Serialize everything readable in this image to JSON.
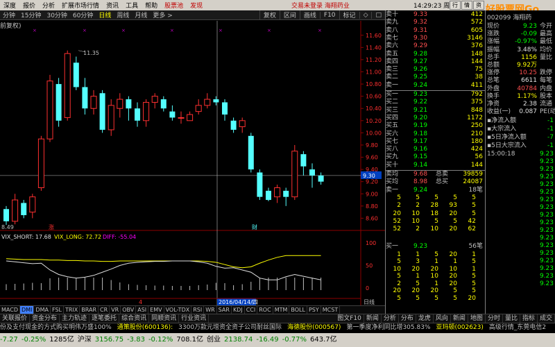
{
  "menu": {
    "items": [
      "深度",
      "报价",
      "分析",
      "扩展市场行情",
      "资讯",
      "工具",
      "帮助"
    ],
    "red_items": [
      "股票池",
      "发现"
    ],
    "notice": [
      "交易未登录",
      "海翔药业"
    ],
    "clock": "14:29:23",
    "weekday": "周五",
    "buttons": [
      "行",
      "情",
      "资"
    ]
  },
  "watermark": "好股票网Go",
  "periods": [
    "分钟",
    "15分钟",
    "30分钟",
    "60分钟",
    "日线",
    "周线",
    "月线",
    "更多 >"
  ],
  "period_right": [
    "复权",
    "区间",
    "画线",
    "F10",
    "标记",
    "◇",
    "□"
  ],
  "chart_title": "前复权)",
  "price_axis": [
    "11.60",
    "11.40",
    "11.20",
    "11.00",
    "10.80",
    "10.60",
    "10.40",
    "10.20",
    "10.00",
    "9.80",
    "9.60",
    "9.40",
    "9.30",
    "9.20",
    "9.00",
    "8.80",
    "8.60"
  ],
  "annotations": {
    "high": "11.35",
    "low": "8.49",
    "zhang": "涨",
    "cai": "财",
    "date": "2016/04/14/四",
    "four": "4"
  },
  "indicator": {
    "short": "VIX_SHORT: 17.68",
    "long": "VIX_LONG: 72.72",
    "diff": "DIFF: -55.04",
    "axis": [
      "100",
      "50",
      "0"
    ]
  },
  "indicator_buttons": [
    "MACD",
    "DMI",
    "DMA",
    "FSL",
    "TRIX",
    "BRAR",
    "CR",
    "VR",
    "OBV",
    "ASI",
    "EMV",
    "VOL-TDX",
    "RSI",
    "WR",
    "SAR",
    "KDJ",
    "CCI",
    "ROC",
    "MTM",
    "BOLL",
    "PSY",
    "MCST"
  ],
  "indicator_active": "DMI",
  "sub_tab": "日线",
  "orderbook": {
    "asks": [
      {
        "label": "卖十",
        "price": "9.33",
        "vol": "412"
      },
      {
        "label": "卖九",
        "price": "9.32",
        "vol": "572"
      },
      {
        "label": "卖八",
        "price": "9.31",
        "vol": "605"
      },
      {
        "label": "卖七",
        "price": "9.30",
        "vol": "3146"
      },
      {
        "label": "卖六",
        "price": "9.29",
        "vol": "376"
      },
      {
        "label": "卖五",
        "price": "9.28",
        "vol": "148"
      },
      {
        "label": "卖四",
        "price": "9.27",
        "vol": "144"
      },
      {
        "label": "卖三",
        "price": "9.26",
        "vol": "75"
      },
      {
        "label": "卖二",
        "price": "9.25",
        "vol": "38"
      },
      {
        "label": "卖一",
        "price": "9.24",
        "vol": "411"
      }
    ],
    "bids": [
      {
        "label": "买一",
        "price": "9.23",
        "vol": "792"
      },
      {
        "label": "买二",
        "price": "9.22",
        "vol": "375"
      },
      {
        "label": "买三",
        "price": "9.21",
        "vol": "848"
      },
      {
        "label": "买四",
        "price": "9.20",
        "vol": "1172"
      },
      {
        "label": "买五",
        "price": "9.19",
        "vol": "250"
      },
      {
        "label": "买六",
        "price": "9.18",
        "vol": "210"
      },
      {
        "label": "买七",
        "price": "9.17",
        "vol": "180"
      },
      {
        "label": "买八",
        "price": "9.16",
        "vol": "424"
      },
      {
        "label": "买九",
        "price": "9.15",
        "vol": "56"
      },
      {
        "label": "买十",
        "price": "9.14",
        "vol": "144"
      }
    ],
    "avg_ask": {
      "label": "卖均",
      "price": "9.68",
      "k": "总卖",
      "v": "39859"
    },
    "avg_bid": {
      "label": "买均",
      "price": "8.98",
      "k": "总买",
      "v": "24087"
    },
    "sell1_row": {
      "label": "卖一",
      "price": "9.24",
      "right": "18笔"
    },
    "buy1_row": {
      "label": "买一",
      "price": "9.23",
      "right": "56笔"
    }
  },
  "ticks_top": [
    [
      "5",
      "5",
      "5",
      "5",
      "5"
    ],
    [
      "2",
      "2",
      "28",
      "93",
      "5"
    ],
    [
      "20",
      "10",
      "18",
      "20",
      "5"
    ],
    [
      "52",
      "10",
      "5",
      "5",
      "42"
    ],
    [
      "52",
      "2",
      "10",
      "20",
      "62"
    ]
  ],
  "ticks_bottom": [
    [
      "1",
      "1",
      "5",
      "20",
      "1"
    ],
    [
      "5",
      "3",
      "1",
      "1",
      "5"
    ],
    [
      "10",
      "20",
      "20",
      "10",
      "1"
    ],
    [
      "5",
      "1",
      "10",
      "20",
      "5"
    ],
    [
      "2",
      "5",
      "1",
      "20",
      "5"
    ],
    [
      "20",
      "20",
      "20",
      "5",
      "5"
    ],
    [
      "5",
      "5",
      "5",
      "5",
      "20"
    ]
  ],
  "info": {
    "code": "002099 海翔药",
    "rows": [
      {
        "k": "现价",
        "v": "9.23",
        "k2": "今开",
        "cls": "g"
      },
      {
        "k": "涨跌",
        "v": "-0.09",
        "k2": "最高",
        "cls": "g"
      },
      {
        "k": "涨幅",
        "v": "-0.97%",
        "k2": "最低",
        "cls": "g"
      },
      {
        "k": "振幅",
        "v": "3.48%",
        "k2": "均价",
        "cls": "w"
      },
      {
        "k": "总手",
        "v": "1156",
        "k2": "量比",
        "cls": "y"
      },
      {
        "k": "总额",
        "v": "9.92万",
        "k2": "",
        "cls": "y"
      },
      {
        "k": "涨停",
        "v": "10.25",
        "k2": "跌停",
        "cls": "r"
      },
      {
        "k": "总笔",
        "v": "6611",
        "k2": "每笔",
        "cls": "w"
      },
      {
        "k": "外盘",
        "v": "40784",
        "k2": "内盘",
        "cls": "r"
      },
      {
        "k": "换手",
        "v": "1.17%",
        "k2": "股本",
        "cls": "y"
      },
      {
        "k": "净资",
        "v": "2.38",
        "k2": "流通",
        "cls": "w"
      },
      {
        "k": "收益(一)",
        "v": "0.087",
        "k2": "PE(动",
        "cls": "w"
      }
    ],
    "flows": [
      {
        "k": "净流入额",
        "v": "-1"
      },
      {
        "k": "大宗流入",
        "v": "-1"
      },
      {
        "k": "5日净流入额",
        "v": "-7"
      },
      {
        "k": "5日大宗流入",
        "v": "-1"
      }
    ],
    "trade_time": "15:00:18",
    "trade_prices": [
      "9.23",
      "9.23",
      "9.23",
      "9.23",
      "9.23",
      "9.23",
      "9.23",
      "9.23",
      "9.23",
      "9.23",
      "9.23",
      "9.23",
      "9.23",
      "9.23",
      "9.23",
      "9.23",
      "9.23",
      "9.23"
    ]
  },
  "tabs": [
    "关联报价",
    "资金分布",
    "主力轨迹",
    "逐笔委托",
    "综合资讯",
    "同顺资讯",
    "行业资讯"
  ],
  "right_tabs": [
    "图文F10",
    "新闻",
    "分析",
    "分布",
    "龙虎",
    "风向",
    "新闻",
    "地图",
    "分时",
    "量比",
    "指标",
    "成交"
  ],
  "news": [
    {
      "t": "份及支付现金的方式购买明伟万盛100%",
      "c": "n"
    },
    {
      "t": "通策股份(600136):",
      "c": "y"
    },
    {
      "t": "3300万款元增资全资子公司耐丝国际",
      "c": "n"
    },
    {
      "t": "海德股份(000567)",
      "c": "y"
    },
    {
      "t": "第一季度净利同比增305.83%",
      "c": "n"
    },
    {
      "t": "亚玛顿(002623)",
      "c": "y"
    },
    {
      "t": "高级行情_东莞电信2",
      "c": "n"
    }
  ],
  "indexbar": [
    {
      "t": "-7.27",
      "neg": true
    },
    {
      "t": "-0.25%",
      "neg": true
    },
    {
      "t": "1285亿",
      "neg": false
    },
    {
      "t": "沪深",
      "neg": false
    },
    {
      "t": "3156.75",
      "neg": true
    },
    {
      "t": "-3.83",
      "neg": true
    },
    {
      "t": "-0.12%",
      "neg": true
    },
    {
      "t": "708.1亿",
      "neg": false
    },
    {
      "t": "创业",
      "neg": false
    },
    {
      "t": "2138.74",
      "neg": true
    },
    {
      "t": "-16.49",
      "neg": true
    },
    {
      "t": "-0.77%",
      "neg": true
    },
    {
      "t": "643.7亿",
      "neg": false
    }
  ],
  "colors": {
    "up": "#ff3030",
    "down": "#54ffff",
    "grid": "#8b0000",
    "line_short": "#e0e0e0",
    "line_long": "#ffff00",
    "diff": "#ff00ff"
  },
  "chart_data": {
    "type": "candlestick",
    "candles": [
      {
        "o": 8.75,
        "c": 8.55,
        "h": 8.8,
        "l": 8.49
      },
      {
        "o": 8.55,
        "c": 8.9,
        "h": 9.0,
        "l": 8.5
      },
      {
        "o": 8.85,
        "c": 8.65,
        "h": 8.9,
        "l": 8.6
      },
      {
        "o": 8.7,
        "c": 8.95,
        "h": 9.0,
        "l": 8.6
      },
      {
        "o": 9.1,
        "c": 9.9,
        "h": 9.95,
        "l": 9.05
      },
      {
        "o": 9.9,
        "c": 10.85,
        "h": 10.95,
        "l": 9.85
      },
      {
        "o": 10.8,
        "c": 10.2,
        "h": 10.9,
        "l": 10.1
      },
      {
        "o": 10.25,
        "c": 11.3,
        "h": 11.35,
        "l": 10.2
      },
      {
        "o": 11.15,
        "c": 10.75,
        "h": 11.25,
        "l": 10.7
      },
      {
        "o": 10.75,
        "c": 10.4,
        "h": 10.9,
        "l": 10.3
      },
      {
        "o": 10.4,
        "c": 10.6,
        "h": 10.7,
        "l": 10.3
      },
      {
        "o": 10.65,
        "c": 10.05,
        "h": 10.7,
        "l": 10.0
      },
      {
        "o": 10.05,
        "c": 10.45,
        "h": 10.55,
        "l": 9.95
      },
      {
        "o": 10.4,
        "c": 10.55,
        "h": 10.65,
        "l": 10.25
      },
      {
        "o": 10.55,
        "c": 10.4,
        "h": 10.6,
        "l": 10.2
      },
      {
        "o": 10.4,
        "c": 10.2,
        "h": 10.5,
        "l": 10.1
      },
      {
        "o": 10.2,
        "c": 10.5,
        "h": 10.55,
        "l": 10.1
      },
      {
        "o": 10.5,
        "c": 10.6,
        "h": 10.65,
        "l": 10.4
      },
      {
        "o": 10.55,
        "c": 10.4,
        "h": 10.6,
        "l": 10.35
      },
      {
        "o": 10.35,
        "c": 10.25,
        "h": 10.45,
        "l": 10.2
      },
      {
        "o": 10.25,
        "c": 10.25,
        "h": 10.35,
        "l": 10.15
      },
      {
        "o": 10.2,
        "c": 10.3,
        "h": 10.35,
        "l": 10.2
      },
      {
        "o": 10.35,
        "c": 10.45,
        "h": 10.55,
        "l": 10.3
      },
      {
        "o": 10.45,
        "c": 10.55,
        "h": 10.65,
        "l": 10.4
      },
      {
        "o": 10.55,
        "c": 10.5,
        "h": 10.6,
        "l": 10.45
      },
      {
        "o": 10.5,
        "c": 10.3,
        "h": 10.55,
        "l": 10.2
      },
      {
        "o": 10.2,
        "c": 10.05,
        "h": 10.25,
        "l": 10.0
      },
      {
        "o": 10.1,
        "c": 10.2,
        "h": 10.25,
        "l": 10.0
      },
      {
        "o": 9.95,
        "c": 9.4,
        "h": 10.0,
        "l": 9.35
      },
      {
        "o": 9.35,
        "c": 8.95,
        "h": 9.4,
        "l": 8.9
      },
      {
        "o": 9.05,
        "c": 8.9,
        "h": 9.1,
        "l": 8.88
      },
      {
        "o": 8.95,
        "c": 9.1,
        "h": 9.15,
        "l": 8.85
      },
      {
        "o": 9.05,
        "c": 8.95,
        "h": 9.1,
        "l": 8.8
      },
      {
        "o": 8.95,
        "c": 9.7,
        "h": 9.8,
        "l": 8.9
      },
      {
        "o": 9.65,
        "c": 9.45,
        "h": 9.7,
        "l": 9.3
      },
      {
        "o": 9.4,
        "c": 9.3,
        "h": 9.5,
        "l": 9.1
      },
      {
        "o": 9.3,
        "c": 9.2,
        "h": 9.35,
        "l": 9.15
      }
    ],
    "ylim": [
      8.4,
      11.7
    ],
    "indicator_short": [
      60,
      58,
      56,
      54,
      55,
      40,
      30,
      25,
      22,
      24,
      28,
      35,
      42,
      50,
      55,
      57,
      58,
      59,
      59,
      60,
      60,
      60,
      58,
      55,
      48,
      44,
      45,
      40,
      35,
      22,
      18,
      18,
      25,
      30,
      26,
      22,
      18
    ],
    "indicator_long": [
      65,
      64,
      63,
      63,
      63,
      62,
      62,
      61,
      61,
      60,
      60,
      59,
      59,
      60,
      60,
      60,
      60,
      60,
      60,
      60,
      60,
      60,
      60,
      59,
      57,
      52,
      47,
      45,
      47,
      55,
      62,
      68,
      72,
      72,
      72,
      72,
      72
    ]
  }
}
